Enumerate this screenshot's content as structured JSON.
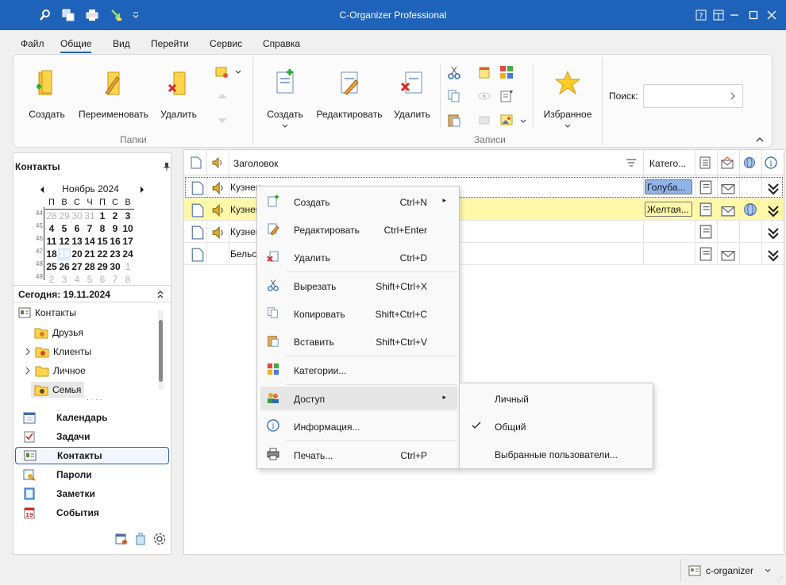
{
  "window": {
    "title": "C-Organizer Professional"
  },
  "menu": [
    "Файл",
    "Общие",
    "Вид",
    "Перейти",
    "Сервис",
    "Справка"
  ],
  "ribbon": {
    "folders_group": "Папки",
    "records_group": "Записи",
    "folder_create": "Создать",
    "folder_rename": "Переименовать",
    "folder_delete": "Удалить",
    "record_create": "Создать",
    "record_edit": "Редактировать",
    "record_delete": "Удалить",
    "favorites": "Избранное",
    "search_label": "Поиск:",
    "search_placeholder": ""
  },
  "left": {
    "header": "Контакты",
    "calendar": {
      "month": "Ноябрь 2024",
      "weekdays": [
        "П",
        "В",
        "С",
        "Ч",
        "П",
        "С",
        "В"
      ],
      "weeks": [
        "44",
        "45",
        "46",
        "47",
        "48",
        "49"
      ],
      "rows": [
        [
          "28",
          "29",
          "30",
          "31",
          "1",
          "2",
          "3"
        ],
        [
          "4",
          "5",
          "6",
          "7",
          "8",
          "9",
          "10"
        ],
        [
          "11",
          "12",
          "13",
          "14",
          "15",
          "16",
          "17"
        ],
        [
          "18",
          "19",
          "20",
          "21",
          "22",
          "23",
          "24"
        ],
        [
          "25",
          "26",
          "27",
          "28",
          "29",
          "30",
          "1"
        ],
        [
          "2",
          "3",
          "4",
          "5",
          "6",
          "7",
          "8"
        ]
      ]
    },
    "today": "Сегодня: 19.11.2024",
    "tree": {
      "root": "Контакты",
      "items": [
        "Друзья",
        "Клиенты",
        "Личное",
        "Семья"
      ]
    },
    "nav": [
      "Календарь",
      "Задачи",
      "Контакты",
      "Пароли",
      "Заметки",
      "События"
    ]
  },
  "grid": {
    "col_title": "Заголовок",
    "col_category": "Катего...",
    "rows": [
      {
        "title": "Кузнец",
        "category": "Голуба..."
      },
      {
        "title": "Кузнец",
        "category": "Желтая..."
      },
      {
        "title": "Кузнец",
        "category": ""
      },
      {
        "title": "Бельск",
        "category": ""
      }
    ]
  },
  "context_menu": {
    "items": [
      {
        "label": "Создать",
        "shortcut": "Ctrl+N",
        "submenu": true
      },
      {
        "label": "Редактировать",
        "shortcut": "Ctrl+Enter"
      },
      {
        "label": "Удалить",
        "shortcut": "Ctrl+D"
      },
      {
        "label": "Вырезать",
        "shortcut": "Shift+Ctrl+X"
      },
      {
        "label": "Копировать",
        "shortcut": "Shift+Ctrl+C"
      },
      {
        "label": "Вставить",
        "shortcut": "Shift+Ctrl+V"
      },
      {
        "label": "Категории...",
        "shortcut": ""
      },
      {
        "label": "Доступ",
        "shortcut": "",
        "submenu": true
      },
      {
        "label": "Информация...",
        "shortcut": ""
      },
      {
        "label": "Печать...",
        "shortcut": "Ctrl+P"
      }
    ]
  },
  "access_submenu": {
    "items": [
      "Личный",
      "Общий",
      "Выбранные пользователи..."
    ],
    "checked": "Общий"
  },
  "status": {
    "user": "c-organizer"
  },
  "colors": {
    "titlebar": "#1f62b9",
    "row_highlight": "#fff8a8",
    "cat_blue": "#8fb4ea",
    "cat_yellow": "#fff8a8"
  }
}
